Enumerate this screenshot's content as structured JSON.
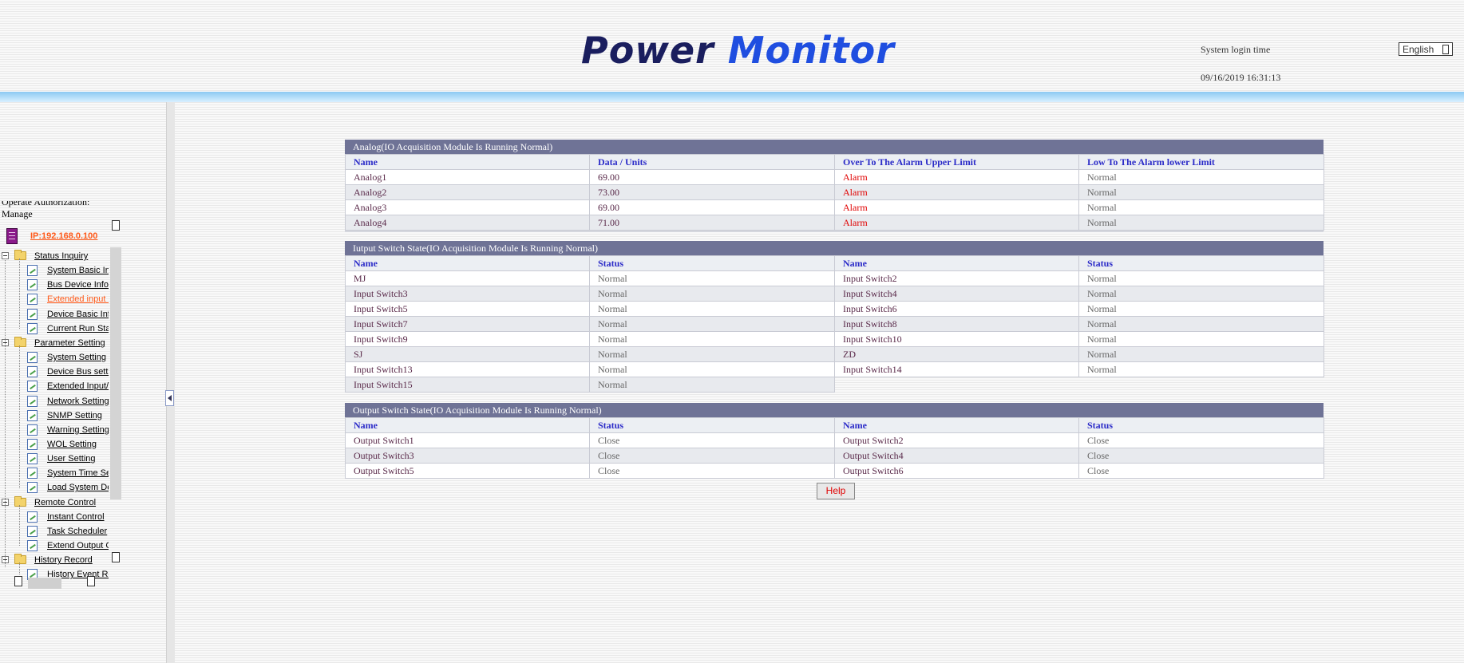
{
  "header": {
    "logo_word1": "Power",
    "logo_word2": "Monitor",
    "login_label": "System login time",
    "login_time": "09/16/2019 16:31:13",
    "language": "English"
  },
  "sidebar": {
    "manage_line1": "Operate Authorization:",
    "manage_line2": "Manage",
    "ip": "IP:192.168.0.100",
    "groups": [
      {
        "label": "Status Inquiry",
        "items": [
          "System Basic In",
          "Bus Device Infor",
          "Extended input I",
          "Device Basic Inf",
          "Current Run Sta"
        ]
      },
      {
        "label": "Parameter Setting",
        "items": [
          "System Setting",
          "Device Bus setti",
          "Extended Input/(",
          "Network Settings",
          "SNMP Setting",
          "Warning Setting",
          "WOL Setting",
          "User Setting",
          "System Time Se",
          "Load System De"
        ]
      },
      {
        "label": "Remote Control",
        "items": [
          "Instant Control",
          "Task Scheduler",
          "Extend Output C"
        ]
      },
      {
        "label": "History Record",
        "items": [
          "History Event Re"
        ]
      }
    ]
  },
  "analog": {
    "title": "Analog(IO Acquisition Module Is Running Normal)",
    "headers": [
      "Name",
      "Data / Units",
      "Over To The Alarm Upper Limit",
      "Low To The Alarm lower Limit"
    ],
    "rows": [
      [
        "Analog1",
        "69.00",
        "Alarm",
        "Normal"
      ],
      [
        "Analog2",
        "73.00",
        "Alarm",
        "Normal"
      ],
      [
        "Analog3",
        "69.00",
        "Alarm",
        "Normal"
      ],
      [
        "Analog4",
        "71.00",
        "Alarm",
        "Normal"
      ]
    ]
  },
  "input": {
    "title": "Iutput Switch State(IO Acquisition Module Is Running Normal)",
    "headers": [
      "Name",
      "Status",
      "Name",
      "Status"
    ],
    "rows": [
      [
        "MJ",
        "Normal",
        "Input Switch2",
        "Normal"
      ],
      [
        "Input Switch3",
        "Normal",
        "Input Switch4",
        "Normal"
      ],
      [
        "Input Switch5",
        "Normal",
        "Input Switch6",
        "Normal"
      ],
      [
        "Input Switch7",
        "Normal",
        "Input Switch8",
        "Normal"
      ],
      [
        "Input Switch9",
        "Normal",
        "Input Switch10",
        "Normal"
      ],
      [
        "SJ",
        "Normal",
        "ZD",
        "Normal"
      ],
      [
        "Input Switch13",
        "Normal",
        "Input Switch14",
        "Normal"
      ],
      [
        "Input Switch15",
        "Normal",
        "",
        ""
      ]
    ]
  },
  "output": {
    "title": "Output Switch State(IO Acquisition Module Is Running Normal)",
    "headers": [
      "Name",
      "Status",
      "Name",
      "Status"
    ],
    "rows": [
      [
        "Output Switch1",
        "Close",
        "Output Switch2",
        "Close"
      ],
      [
        "Output Switch3",
        "Close",
        "Output Switch4",
        "Close"
      ],
      [
        "Output Switch5",
        "Close",
        "Output Switch6",
        "Close"
      ]
    ]
  },
  "help_label": "Help"
}
